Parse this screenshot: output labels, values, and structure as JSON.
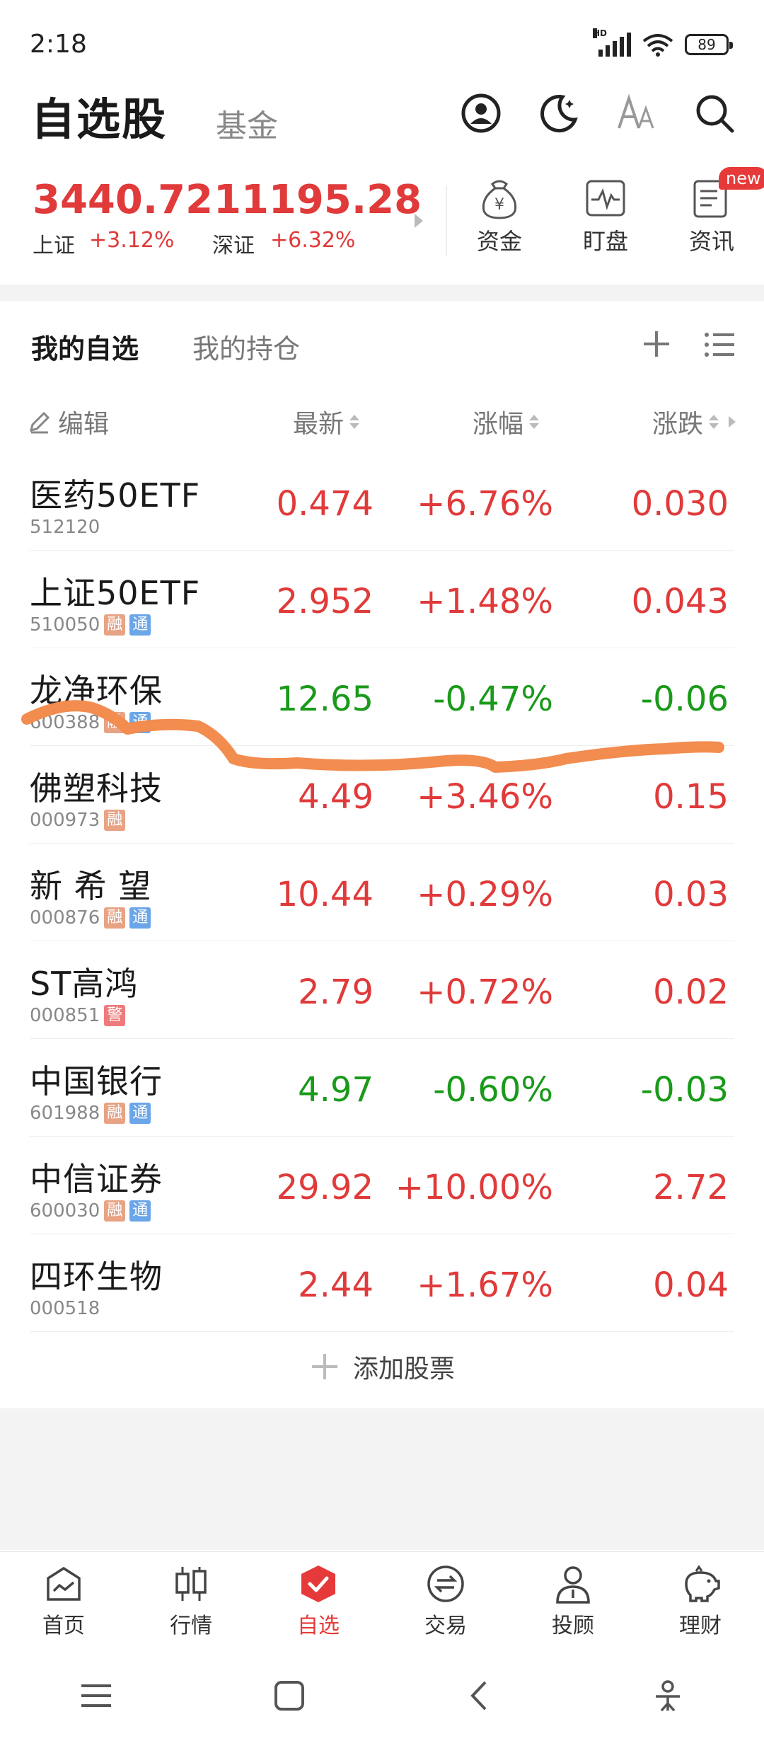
{
  "status": {
    "time": "2:18",
    "network_badge": "HD",
    "battery": "89"
  },
  "header": {
    "title": "自选股",
    "tab_fund": "基金"
  },
  "indices": [
    {
      "value": "3440.72",
      "name": "上证",
      "pct": "+3.12%"
    },
    {
      "value": "11195.28",
      "name": "深证",
      "pct": "+6.32%"
    }
  ],
  "tools": [
    {
      "label": "资金",
      "icon": "money-bag-icon"
    },
    {
      "label": "盯盘",
      "icon": "monitor-chart-icon"
    },
    {
      "label": "资讯",
      "icon": "news-icon",
      "badge": "new"
    }
  ],
  "tabs": {
    "mine": "我的自选",
    "holdings": "我的持仓"
  },
  "columns": {
    "edit": "编辑",
    "latest": "最新",
    "pct": "涨幅",
    "change": "涨跌"
  },
  "tags": {
    "rong": "融",
    "tong": "通",
    "jing": "警"
  },
  "stocks": [
    {
      "name": "医药50ETF",
      "code": "512120",
      "price": "0.474",
      "pct": "+6.76%",
      "chg": "0.030",
      "dir": "up"
    },
    {
      "name": "上证50ETF",
      "code": "510050",
      "price": "2.952",
      "pct": "+1.48%",
      "chg": "0.043",
      "dir": "up"
    },
    {
      "name": "龙净环保",
      "code": "600388",
      "price": "12.65",
      "pct": "-0.47%",
      "chg": "-0.06",
      "dir": "down"
    },
    {
      "name": "佛塑科技",
      "code": "000973",
      "price": "4.49",
      "pct": "+3.46%",
      "chg": "0.15",
      "dir": "up"
    },
    {
      "name": "新 希 望",
      "code": "000876",
      "price": "10.44",
      "pct": "+0.29%",
      "chg": "0.03",
      "dir": "up"
    },
    {
      "name": "ST高鸿",
      "code": "000851",
      "price": "2.79",
      "pct": "+0.72%",
      "chg": "0.02",
      "dir": "up"
    },
    {
      "name": "中国银行",
      "code": "601988",
      "price": "4.97",
      "pct": "-0.60%",
      "chg": "-0.03",
      "dir": "down"
    },
    {
      "name": "中信证券",
      "code": "600030",
      "price": "29.92",
      "pct": "+10.00%",
      "chg": "2.72",
      "dir": "up"
    },
    {
      "name": "四环生物",
      "code": "000518",
      "price": "2.44",
      "pct": "+1.67%",
      "chg": "0.04",
      "dir": "up"
    }
  ],
  "add_stock": "添加股票",
  "bottom_nav": [
    {
      "label": "首页",
      "icon": "home-chart-icon"
    },
    {
      "label": "行情",
      "icon": "candlestick-icon"
    },
    {
      "label": "自选",
      "icon": "favorite-check-icon",
      "active": true
    },
    {
      "label": "交易",
      "icon": "exchange-icon"
    },
    {
      "label": "投顾",
      "icon": "advisor-icon"
    },
    {
      "label": "理财",
      "icon": "piggy-bank-icon"
    }
  ],
  "colors": {
    "up": "#e03a3a",
    "down": "#1a9a1a",
    "accent": "#e63a3a",
    "annotation_stroke": "#f28c4f"
  }
}
